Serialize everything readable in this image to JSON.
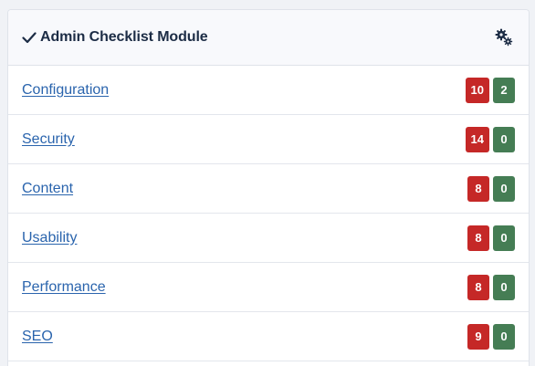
{
  "module": {
    "title": "Admin Checklist Module",
    "icon": "check-icon",
    "settings_icon": "gears-icon"
  },
  "colors": {
    "fail_badge": "#c52827",
    "pass_badge": "#457d54",
    "link": "#2a64ad"
  },
  "items": [
    {
      "label": "Configuration",
      "fail": "10",
      "pass": "2"
    },
    {
      "label": "Security",
      "fail": "14",
      "pass": "0"
    },
    {
      "label": "Content",
      "fail": "8",
      "pass": "0"
    },
    {
      "label": "Usability",
      "fail": "8",
      "pass": "0"
    },
    {
      "label": "Performance",
      "fail": "8",
      "pass": "0"
    },
    {
      "label": "SEO",
      "fail": "9",
      "pass": "0"
    }
  ]
}
